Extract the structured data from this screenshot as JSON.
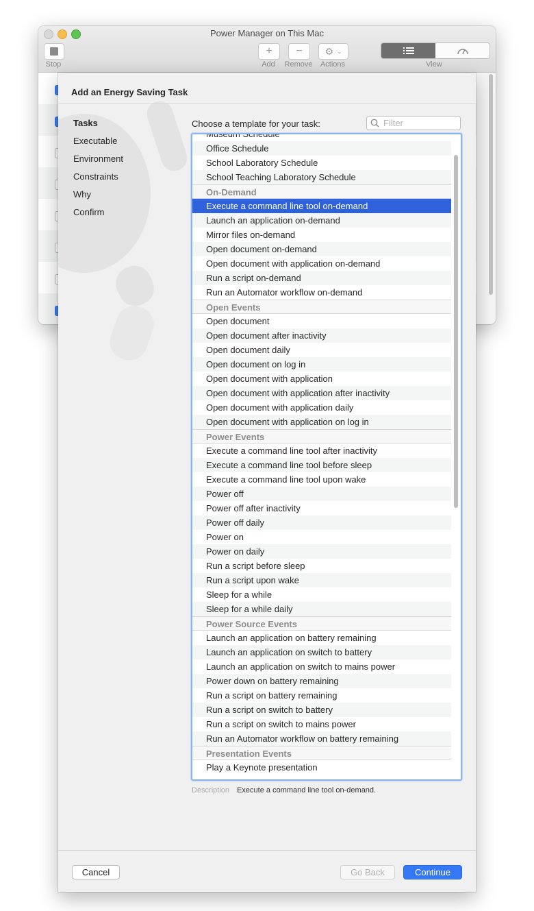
{
  "window": {
    "title": "Power Manager on This Mac",
    "toolbar": {
      "stop_label": "Stop",
      "add_label": "Add",
      "remove_label": "Remove",
      "actions_label": "Actions",
      "view_label": "View"
    }
  },
  "sheet": {
    "title": "Add an Energy Saving Task",
    "steps": [
      "Tasks",
      "Executable",
      "Environment",
      "Constraints",
      "Why",
      "Confirm"
    ],
    "active_step": "Tasks",
    "prompt": "Choose a template for your task:",
    "filter_placeholder": "Filter",
    "templates": [
      {
        "label": "Museum Schedule",
        "kind": "item"
      },
      {
        "label": "Office Schedule",
        "kind": "item"
      },
      {
        "label": "School Laboratory Schedule",
        "kind": "item"
      },
      {
        "label": "School Teaching Laboratory Schedule",
        "kind": "item"
      },
      {
        "label": "On-Demand",
        "kind": "header"
      },
      {
        "label": "Execute a command line tool on-demand",
        "kind": "item",
        "selected": true
      },
      {
        "label": "Launch an application on-demand",
        "kind": "item"
      },
      {
        "label": "Mirror files on-demand",
        "kind": "item"
      },
      {
        "label": "Open document on-demand",
        "kind": "item"
      },
      {
        "label": "Open document with application on-demand",
        "kind": "item"
      },
      {
        "label": "Run a script on-demand",
        "kind": "item"
      },
      {
        "label": "Run an Automator workflow on-demand",
        "kind": "item"
      },
      {
        "label": "Open Events",
        "kind": "header"
      },
      {
        "label": "Open document",
        "kind": "item"
      },
      {
        "label": "Open document after inactivity",
        "kind": "item"
      },
      {
        "label": "Open document daily",
        "kind": "item"
      },
      {
        "label": "Open document on log in",
        "kind": "item"
      },
      {
        "label": "Open document with application",
        "kind": "item"
      },
      {
        "label": "Open document with application after inactivity",
        "kind": "item"
      },
      {
        "label": "Open document with application daily",
        "kind": "item"
      },
      {
        "label": "Open document with application on log in",
        "kind": "item"
      },
      {
        "label": "Power Events",
        "kind": "header"
      },
      {
        "label": "Execute a command line tool after inactivity",
        "kind": "item"
      },
      {
        "label": "Execute a command line tool before sleep",
        "kind": "item"
      },
      {
        "label": "Execute a command line tool upon wake",
        "kind": "item"
      },
      {
        "label": "Power off",
        "kind": "item"
      },
      {
        "label": "Power off after inactivity",
        "kind": "item"
      },
      {
        "label": "Power off daily",
        "kind": "item"
      },
      {
        "label": "Power on",
        "kind": "item"
      },
      {
        "label": "Power on daily",
        "kind": "item"
      },
      {
        "label": "Run a script before sleep",
        "kind": "item"
      },
      {
        "label": "Run a script upon wake",
        "kind": "item"
      },
      {
        "label": "Sleep for a while",
        "kind": "item"
      },
      {
        "label": "Sleep for a while daily",
        "kind": "item"
      },
      {
        "label": "Power Source Events",
        "kind": "header"
      },
      {
        "label": "Launch an application on battery remaining",
        "kind": "item"
      },
      {
        "label": "Launch an application on switch to battery",
        "kind": "item"
      },
      {
        "label": "Launch an application on switch to mains power",
        "kind": "item"
      },
      {
        "label": "Power down on battery remaining",
        "kind": "item"
      },
      {
        "label": "Run a script on battery remaining",
        "kind": "item"
      },
      {
        "label": "Run a script on switch to battery",
        "kind": "item"
      },
      {
        "label": "Run a script on switch to mains power",
        "kind": "item"
      },
      {
        "label": "Run an Automator workflow on battery remaining",
        "kind": "item"
      },
      {
        "label": "Presentation Events",
        "kind": "header"
      },
      {
        "label": "Play a Keynote presentation",
        "kind": "item"
      }
    ],
    "description_label": "Description",
    "description_text": "Execute a command line tool on-demand.",
    "buttons": {
      "cancel": "Cancel",
      "go_back": "Go Back",
      "continue": "Continue"
    }
  },
  "colors": {
    "selection": "#2f61db",
    "accent_button": "#3478f6",
    "focus_ring": "#8db4f0"
  }
}
